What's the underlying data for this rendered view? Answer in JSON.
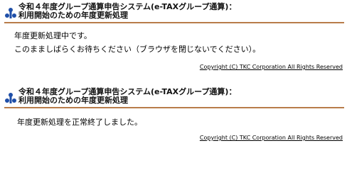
{
  "colors": {
    "rule": "#b87c4a",
    "logo_blue": "#1f4fa8"
  },
  "panel1": {
    "title_line1": "令和４年度グループ通算申告システム(e-TAXグループ通算)：",
    "title_line2": "利用開始のための年度更新処理",
    "message_line1": "年度更新処理中です。",
    "message_line2": "このまましばらくお待ちください（ブラウザを閉じないでください）。",
    "copyright": "Copyright (C) TKC Corporation All Rights Reserved",
    "logo_icon": "tkc-logo-icon"
  },
  "panel2": {
    "title_line1": "令和４年度グループ通算申告システム(e-TAXグループ通算)：",
    "title_line2": "利用開始のための年度更新処理",
    "message_line1": "年度更新処理を正常終了しました。",
    "copyright": "Copyright (C) TKC Corporation All Rights Reserved",
    "logo_icon": "tkc-logo-icon"
  }
}
